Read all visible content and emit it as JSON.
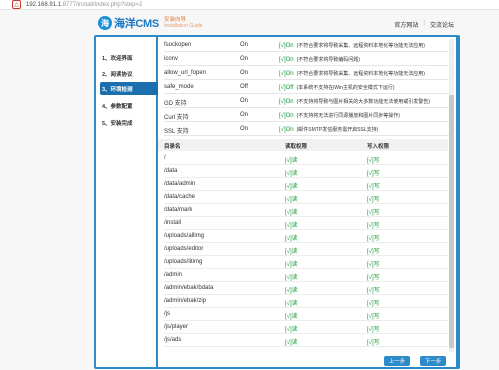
{
  "browser": {
    "warning": "△",
    "url_host": "192.168.91.1",
    "url_rest": ":8777/install/index.php?step=2"
  },
  "header": {
    "logo_char": "海",
    "logo_text": "海洋CMS",
    "logo_sub1": "安装向导",
    "logo_sub2": "Installation Guide",
    "links": {
      "official": "官方网站",
      "sep": "|",
      "forum": "交流论坛"
    }
  },
  "sidebar": {
    "items": [
      {
        "label": "1、欢迎界面"
      },
      {
        "label": "2、阅读协议"
      },
      {
        "label": "3、环境检测"
      },
      {
        "label": "4、参数配置"
      },
      {
        "label": "5、安装完成"
      }
    ],
    "active_index": 2
  },
  "settings": [
    {
      "name": "fsockopen",
      "state": "On",
      "result": "[√]On",
      "note": "(不符合要求将导致采集、远程资料本地化等功能无法应用)"
    },
    {
      "name": "iconv",
      "state": "On",
      "result": "[√]On",
      "note": "(不符合要求将导致编码问题)"
    },
    {
      "name": "allow_url_fopen",
      "state": "On",
      "result": "[√]On",
      "note": "(不符合要求将导致采集、远程资料本地化等功能无法应用)"
    },
    {
      "name": "safe_mode",
      "state": "Off",
      "result": "[√]Off",
      "note": "(本系统不支持在iWin主机的安全模式下运行)"
    },
    {
      "name": "GD 支持",
      "state": "On",
      "result": "[√]On",
      "note": "(不支持将导致与图片相关的大多数功能无法使用或引发警告)"
    },
    {
      "name": "Curl 支持",
      "state": "On",
      "result": "[√]On",
      "note": "(不支持将无法进行同源播放和图片同步等操作)"
    },
    {
      "name": "SSL 支持",
      "state": "On",
      "result": "[√]On",
      "note": "(邮件SMTP发信服务需开启SSL支持)"
    }
  ],
  "dirs": {
    "headers": {
      "path": "目录名",
      "read": "读取权限",
      "write": "写入权限"
    },
    "rows": [
      {
        "path": "/",
        "read": "[√]读",
        "write": "[√]写"
      },
      {
        "path": "/data",
        "read": "[√]读",
        "write": "[√]写"
      },
      {
        "path": "/data/admin",
        "read": "[√]读",
        "write": "[√]写"
      },
      {
        "path": "/data/cache",
        "read": "[√]读",
        "write": "[√]写"
      },
      {
        "path": "/data/mark",
        "read": "[√]读",
        "write": "[√]写"
      },
      {
        "path": "/install",
        "read": "[√]读",
        "write": "[√]写"
      },
      {
        "path": "/uploads/allimg",
        "read": "[√]读",
        "write": "[√]写"
      },
      {
        "path": "/uploads/editor",
        "read": "[√]读",
        "write": "[√]写"
      },
      {
        "path": "/uploads/litimg",
        "read": "[√]读",
        "write": "[√]写"
      },
      {
        "path": "/admin",
        "read": "[√]读",
        "write": "[√]写"
      },
      {
        "path": "/admin/ebak/bdata",
        "read": "[√]读",
        "write": "[√]写"
      },
      {
        "path": "/admin/ebak/zip",
        "read": "[√]读",
        "write": "[√]写"
      },
      {
        "path": "/js",
        "read": "[√]读",
        "write": "[√]写"
      },
      {
        "path": "/js/player",
        "read": "[√]读",
        "write": "[√]写"
      },
      {
        "path": "/js/ads",
        "read": "[√]读",
        "write": "[√]写"
      }
    ]
  },
  "buttons": {
    "prev": "上一步",
    "next": "下一步"
  },
  "colors": {
    "accent": "#2d8bc9",
    "active_nav": "#1b6fae",
    "ok_green": "#1a9a3a",
    "logo_orange": "#e27a3f"
  }
}
